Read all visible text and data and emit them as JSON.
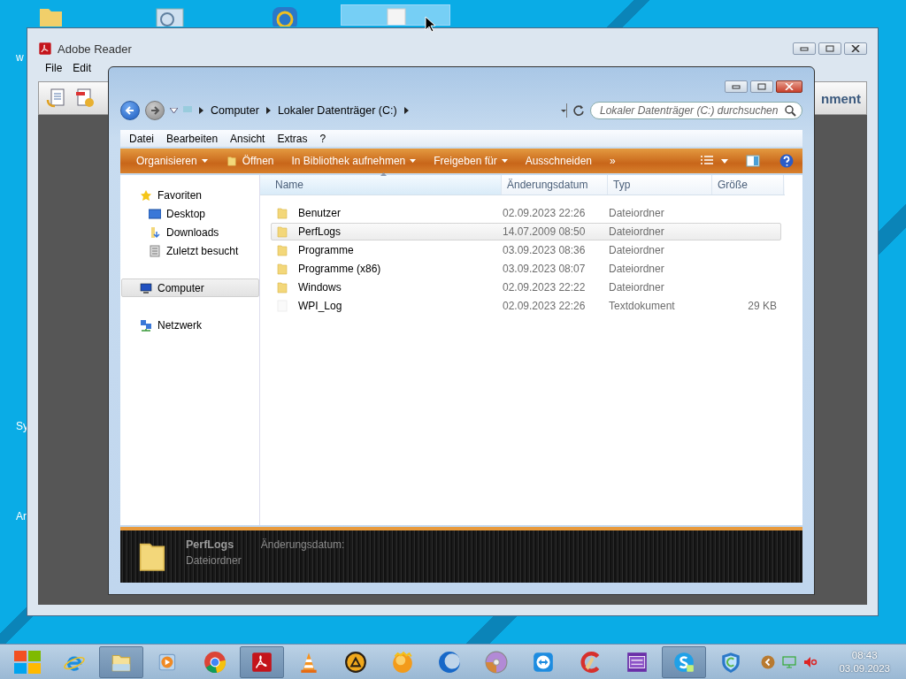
{
  "desktop": {
    "icons": [
      {
        "selected": false
      },
      {
        "selected": false
      },
      {
        "selected": false
      },
      {
        "selected": true
      }
    ],
    "labels": [
      "w",
      "Sy",
      "Ar"
    ]
  },
  "reader": {
    "title": "Adobe Reader",
    "menu": [
      "File",
      "Edit"
    ],
    "toolbar_button": "nment"
  },
  "explorer": {
    "breadcrumb": [
      "Computer",
      "Lokaler Datenträger (C:)"
    ],
    "search": {
      "placeholder": "Lokaler Datenträger (C:) durchsuchen"
    },
    "menu": [
      "Datei",
      "Bearbeiten",
      "Ansicht",
      "Extras",
      "?"
    ],
    "commands": [
      {
        "label": "Organisieren",
        "dropdown": true,
        "icon": false
      },
      {
        "label": "Öffnen",
        "dropdown": false,
        "icon": true
      },
      {
        "label": "In Bibliothek aufnehmen",
        "dropdown": true,
        "icon": false
      },
      {
        "label": "Freigeben für",
        "dropdown": true,
        "icon": false
      },
      {
        "label": "Ausschneiden",
        "dropdown": false,
        "icon": false
      },
      {
        "label": "»",
        "dropdown": false,
        "icon": false
      }
    ],
    "nav": [
      {
        "label": "Favoriten",
        "selected": false,
        "children": [
          {
            "label": "Desktop",
            "selected": false
          },
          {
            "label": "Downloads",
            "selected": false
          },
          {
            "label": "Zuletzt besucht",
            "selected": false
          }
        ]
      },
      {
        "label": "Computer",
        "selected": true
      },
      {
        "label": "Netzwerk",
        "selected": false
      }
    ],
    "columns": [
      {
        "label": "Name",
        "sorted": true
      },
      {
        "label": "Änderungsdatum",
        "sorted": false
      },
      {
        "label": "Typ",
        "sorted": false
      },
      {
        "label": "Größe",
        "sorted": false
      }
    ],
    "rows": [
      {
        "kind": "folder",
        "name": "Benutzer",
        "date": "02.09.2023 22:26",
        "type": "Dateiordner",
        "selected": false
      },
      {
        "kind": "folder",
        "name": "PerfLogs",
        "date": "14.07.2009 08:50",
        "type": "Dateiordner",
        "selected": true
      },
      {
        "kind": "folder",
        "name": "Programme",
        "date": "03.09.2023 08:36",
        "type": "Dateiordner",
        "selected": false
      },
      {
        "kind": "folder",
        "name": "Programme (x86)",
        "date": "03.09.2023 08:07",
        "type": "Dateiordner",
        "selected": false
      },
      {
        "kind": "folder",
        "name": "Windows",
        "date": "02.09.2023 22:22",
        "type": "Dateiordner",
        "selected": false
      },
      {
        "kind": "file",
        "name": "WPI_Log",
        "date": "02.09.2023 22:26",
        "type": "Textdokument",
        "size": "29 KB",
        "selected": false
      }
    ],
    "details": {
      "name": "PerfLogs",
      "label": "Änderungsdatum:",
      "type": "Dateiordner"
    }
  },
  "taskbar": {
    "apps": [
      {
        "active": false
      },
      {
        "active": true
      },
      {
        "active": false
      },
      {
        "active": false
      },
      {
        "active": true
      },
      {
        "active": false
      },
      {
        "active": false
      },
      {
        "active": false
      },
      {
        "active": false
      },
      {
        "active": false
      },
      {
        "active": false
      },
      {
        "active": false
      },
      {
        "active": false
      },
      {
        "active": true
      },
      {
        "active": false
      }
    ],
    "time": "08:43",
    "date": "03.09.2023"
  }
}
